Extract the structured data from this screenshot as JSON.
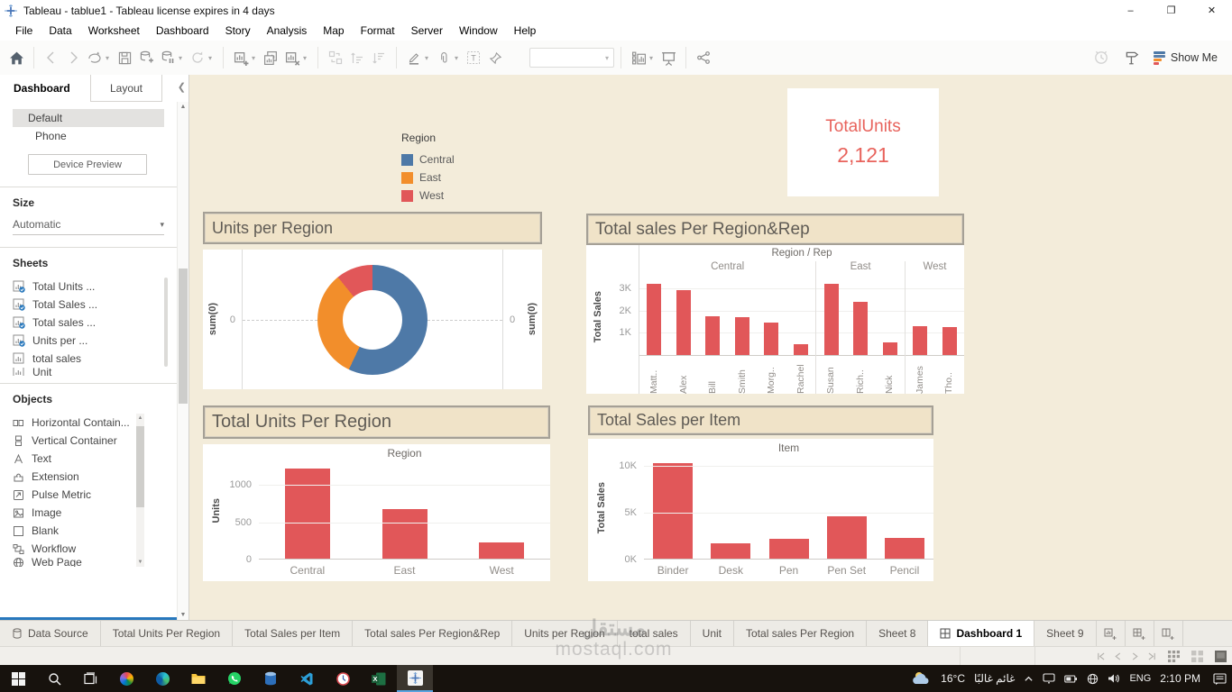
{
  "window": {
    "title": "Tableau - tablue1 - Tableau license expires in 4 days"
  },
  "menu": {
    "items": [
      "File",
      "Data",
      "Worksheet",
      "Dashboard",
      "Story",
      "Analysis",
      "Map",
      "Format",
      "Server",
      "Window",
      "Help"
    ]
  },
  "toolbar": {
    "show_me_label": "Show Me"
  },
  "left_panel": {
    "tab_dashboard": "Dashboard",
    "tab_layout": "Layout",
    "device_default": "Default",
    "device_phone": "Phone",
    "device_preview_label": "Device Preview",
    "size_label": "Size",
    "size_value": "Automatic",
    "sheets_label": "Sheets",
    "sheets": [
      {
        "label": "Total Units ...",
        "used": true
      },
      {
        "label": "Total Sales ...",
        "used": true
      },
      {
        "label": "Total sales ...",
        "used": true
      },
      {
        "label": "Units per ...",
        "used": true
      },
      {
        "label": "total sales",
        "used": false
      },
      {
        "label": "Unit",
        "used": false,
        "clipped": true
      }
    ],
    "objects_label": "Objects",
    "objects": [
      {
        "label": "Horizontal Contain...",
        "icon": "horizontal-container"
      },
      {
        "label": "Vertical Container",
        "icon": "vertical-container"
      },
      {
        "label": "Text",
        "icon": "text"
      },
      {
        "label": "Extension",
        "icon": "extension"
      },
      {
        "label": "Pulse Metric",
        "icon": "pulse-metric"
      },
      {
        "label": "Image",
        "icon": "image"
      },
      {
        "label": "Blank",
        "icon": "blank"
      },
      {
        "label": "Workflow",
        "icon": "workflow"
      },
      {
        "label": "Web Page",
        "icon": "web-page",
        "clipped": true
      }
    ]
  },
  "dashboard": {
    "legend": {
      "title": "Region",
      "items": [
        {
          "label": "Central",
          "color": "#4e79a7"
        },
        {
          "label": "East",
          "color": "#f28e2b"
        },
        {
          "label": "West",
          "color": "#e15759"
        }
      ]
    },
    "kpi": {
      "title": "TotalUnits",
      "value": "2,121",
      "color": "#e8635c"
    }
  },
  "chart_data": [
    {
      "type": "pie",
      "title": "Units per Region",
      "donut": true,
      "axis_label": "sum(0)",
      "tick": "0",
      "slices": [
        {
          "label": "Central",
          "value": 1211,
          "color": "#4e79a7"
        },
        {
          "label": "East",
          "value": 680,
          "color": "#f28e2b"
        },
        {
          "label": "West",
          "value": 230,
          "color": "#e15759"
        }
      ]
    },
    {
      "type": "bar",
      "title": "Total sales Per Region&Rep",
      "col_header": "Region / Rep",
      "ylabel": "Total Sales",
      "ylim": [
        0,
        3400
      ],
      "yticks": [
        {
          "label": "1K",
          "value": 1000
        },
        {
          "label": "2K",
          "value": 2000
        },
        {
          "label": "3K",
          "value": 3000
        }
      ],
      "bar_color": "#e15759",
      "groups": [
        {
          "name": "Central",
          "categories": [
            "Matt..",
            "Alex",
            "Bill",
            "Smith",
            "Morg..",
            "Rachel"
          ],
          "values": [
            3200,
            2900,
            1750,
            1700,
            1450,
            500
          ]
        },
        {
          "name": "East",
          "categories": [
            "Susan",
            "Rich..",
            "Nick"
          ],
          "values": [
            3200,
            2400,
            550
          ]
        },
        {
          "name": "West",
          "categories": [
            "James",
            "Tho.."
          ],
          "values": [
            1300,
            1250
          ]
        }
      ]
    },
    {
      "type": "bar",
      "title": "Total Units Per Region",
      "col_header": "Region",
      "ylabel": "Units",
      "ylim": [
        0,
        1300
      ],
      "yticks": [
        {
          "label": "0",
          "value": 0
        },
        {
          "label": "500",
          "value": 500
        },
        {
          "label": "1000",
          "value": 1000
        }
      ],
      "bar_color": "#e15759",
      "categories": [
        "Central",
        "East",
        "West"
      ],
      "values": [
        1211,
        680,
        230
      ]
    },
    {
      "type": "bar",
      "title": "Total Sales per Item",
      "col_header": "Item",
      "ylabel": "Total Sales",
      "ylim": [
        0,
        11000
      ],
      "yticks": [
        {
          "label": "0K",
          "value": 0
        },
        {
          "label": "5K",
          "value": 5000
        },
        {
          "label": "10K",
          "value": 10000
        }
      ],
      "bar_color": "#e15759",
      "categories": [
        "Binder",
        "Desk",
        "Pen",
        "Pen Set",
        "Pencil"
      ],
      "values": [
        10300,
        1700,
        2200,
        4600,
        2300
      ]
    }
  ],
  "sheet_tabs": {
    "items": [
      "Data Source",
      "Total Units Per Region",
      "Total Sales per Item",
      "Total sales Per Region&Rep",
      "Units per Region",
      "total sales",
      "Unit",
      "Total sales Per Region",
      "Sheet 8",
      "Dashboard 1",
      "Sheet 9"
    ],
    "active": "Dashboard 1"
  },
  "taskbar": {
    "apps": [
      "start",
      "search",
      "task-view",
      "photos",
      "edge",
      "file-explorer",
      "whatsapp",
      "sql-server",
      "vscode",
      "clock",
      "excel",
      "tableau"
    ],
    "active_app": "tableau",
    "temp": "16°C",
    "weather": "غائم غالبًا",
    "lang": "ENG",
    "time": "2:10 PM"
  },
  "watermark": {
    "line1": "مستقل",
    "line2": "mostaql.com"
  }
}
